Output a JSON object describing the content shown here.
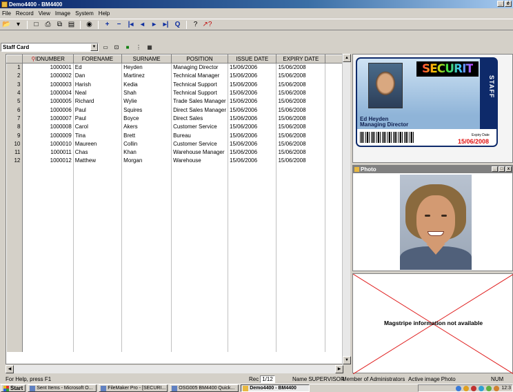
{
  "window": {
    "title": "Demo4400 - BM4400",
    "min": "_",
    "restore": "é",
    "close": "x"
  },
  "menu": [
    "File",
    "Record",
    "View",
    "Image",
    "System",
    "Help"
  ],
  "toolbar": [
    {
      "name": "open-icon",
      "glyph": "📂"
    },
    {
      "name": "dropdown-icon",
      "glyph": "▾"
    },
    {
      "name": "print-preview-icon",
      "glyph": "□"
    },
    {
      "name": "print-icon",
      "glyph": "⎙"
    },
    {
      "name": "copy-icon",
      "glyph": "⧉"
    },
    {
      "name": "paste-icon",
      "glyph": "▤"
    },
    {
      "name": "camera-icon",
      "glyph": "◉"
    },
    {
      "name": "add-record-icon",
      "glyph": "+"
    },
    {
      "name": "delete-record-icon",
      "glyph": "−"
    },
    {
      "name": "first-record-icon",
      "glyph": "|◂"
    },
    {
      "name": "previous-record-icon",
      "glyph": "◂"
    },
    {
      "name": "next-record-icon",
      "glyph": "▸"
    },
    {
      "name": "last-record-icon",
      "glyph": "▸|"
    },
    {
      "name": "find-icon",
      "glyph": "Q"
    },
    {
      "name": "help-icon",
      "glyph": "?"
    },
    {
      "name": "context-help-icon",
      "glyph": "↗?"
    }
  ],
  "card_selector": {
    "value": "Staff Card"
  },
  "grid": {
    "columns": [
      "IDNUMBER",
      "FORENAME",
      "SURNAME",
      "POSITION",
      "ISSUE DATE",
      "EXPIRY DATE"
    ],
    "rows": [
      {
        "n": "1",
        "id": "1000001",
        "forename": "Ed",
        "surname": "Heyden",
        "position": "Managing Director",
        "issue": "15/06/2006",
        "expiry": "15/06/2008"
      },
      {
        "n": "2",
        "id": "1000002",
        "forename": "Dan",
        "surname": "Martinez",
        "position": "Technical Manager",
        "issue": "15/06/2006",
        "expiry": "15/06/2008"
      },
      {
        "n": "3",
        "id": "1000003",
        "forename": "Harish",
        "surname": "Kedia",
        "position": "Technical Support",
        "issue": "15/06/2006",
        "expiry": "15/06/2008"
      },
      {
        "n": "4",
        "id": "1000004",
        "forename": "Neal",
        "surname": "Shah",
        "position": "Technical Support",
        "issue": "15/06/2006",
        "expiry": "15/06/2008"
      },
      {
        "n": "5",
        "id": "1000005",
        "forename": "Richard",
        "surname": "Wylie",
        "position": "Trade Sales Manager",
        "issue": "15/06/2006",
        "expiry": "15/06/2008"
      },
      {
        "n": "6",
        "id": "1000006",
        "forename": "Paul",
        "surname": "Squires",
        "position": "Direct Sales Manager",
        "issue": "15/06/2006",
        "expiry": "15/06/2008"
      },
      {
        "n": "7",
        "id": "1000007",
        "forename": "Paul",
        "surname": "Boyce",
        "position": "Direct Sales",
        "issue": "15/06/2006",
        "expiry": "15/06/2008"
      },
      {
        "n": "8",
        "id": "1000008",
        "forename": "Carol",
        "surname": "Akers",
        "position": "Customer Service",
        "issue": "15/06/2006",
        "expiry": "15/06/2008"
      },
      {
        "n": "9",
        "id": "1000009",
        "forename": "Tina",
        "surname": "Brett",
        "position": "Bureau",
        "issue": "15/06/2006",
        "expiry": "15/06/2008"
      },
      {
        "n": "10",
        "id": "1000010",
        "forename": "Maureen",
        "surname": "Collin",
        "position": "Customer Service",
        "issue": "15/06/2006",
        "expiry": "15/06/2008"
      },
      {
        "n": "11",
        "id": "1000011",
        "forename": "Chas",
        "surname": "Khan",
        "position": "Warehouse Manager",
        "issue": "15/06/2006",
        "expiry": "15/06/2008"
      },
      {
        "n": "12",
        "id": "1000012",
        "forename": "Matthew",
        "surname": "Morgan",
        "position": "Warehouse",
        "issue": "15/06/2006",
        "expiry": "15/06/2008"
      }
    ]
  },
  "card": {
    "logo": "SECURIT",
    "staff_label": "STAFF",
    "name": "Ed Heyden",
    "title": "Managing Director",
    "expiry_label": "Expiry Date",
    "expiry_date": "15/06/2008"
  },
  "photo_window": {
    "title": "Photo"
  },
  "magstripe": {
    "message": "Magstripe information not available"
  },
  "status": {
    "help": "For Help, press F1",
    "rec_label": "Rec",
    "rec_value": "1/12",
    "name_label": "Name",
    "name_value": "SUPERVISOR",
    "member_label": "Member of",
    "member_value": "Administrators",
    "active_label": "Active image",
    "active_value": "Photo",
    "num": "NUM"
  },
  "taskbar": {
    "start": "Start",
    "tasks": [
      "Sent Items - Microsoft O...",
      "FileMaker Pro - [SECURI...",
      "OSG005 BM4400 Quick...",
      "Demo4400 - BM4400"
    ],
    "clock": "12:3"
  },
  "colors": {
    "title_bar": "#0a246a",
    "card_border": "#0e2a6a",
    "expiry_red": "#e01010",
    "cross_red": "#e02020"
  }
}
